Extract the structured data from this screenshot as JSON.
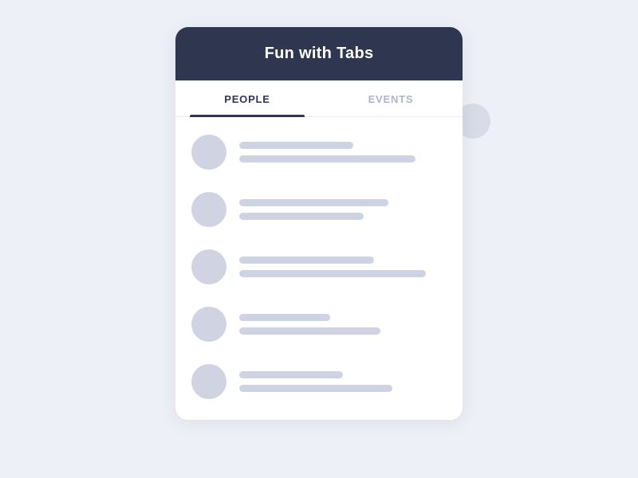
{
  "page": {
    "background_color": "#eef0f7"
  },
  "header": {
    "title": "Fun with Tabs",
    "background_color": "#2e3650"
  },
  "tabs": [
    {
      "id": "people",
      "label": "PEOPLE",
      "active": true
    },
    {
      "id": "events",
      "label": "EVENTS",
      "active": false
    }
  ],
  "list_items": [
    {
      "id": 1,
      "line1_width": "55%",
      "line2_width": "72%"
    },
    {
      "id": 2,
      "line1_width": "60%",
      "line2_width": "65%"
    },
    {
      "id": 3,
      "line1_width": "68%",
      "line2_width": "80%"
    },
    {
      "id": 4,
      "line1_width": "48%",
      "line2_width": "62%"
    },
    {
      "id": 5,
      "line1_width": "52%",
      "line2_width": "70%"
    }
  ],
  "floating_circle": {
    "visible": true
  }
}
